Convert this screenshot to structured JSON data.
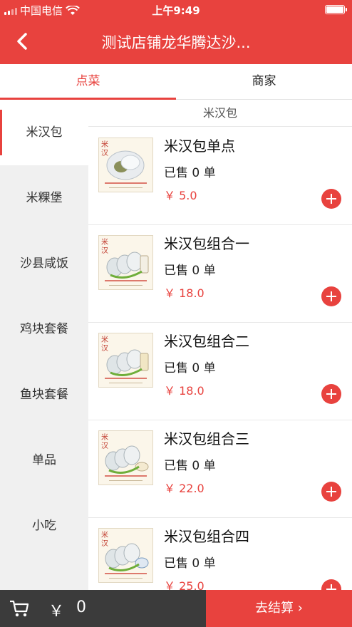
{
  "status_bar": {
    "carrier": "中国电信",
    "time": "上午9:49"
  },
  "header": {
    "title": "测试店铺龙华腾达沙..."
  },
  "tabs": [
    {
      "label": "点菜",
      "active": true
    },
    {
      "label": "商家",
      "active": false
    }
  ],
  "sidebar": {
    "categories": [
      "米汉包",
      "米粿堡",
      "沙县咸饭",
      "鸡块套餐",
      "鱼块套餐",
      "单品",
      "小吃"
    ],
    "active_index": 0
  },
  "main": {
    "section_title": "米汉包",
    "products": [
      {
        "name": "米汉包单点",
        "sold": "已售 0 单",
        "price": "￥ 5.0",
        "image_icon": "rice-burger-photo"
      },
      {
        "name": "米汉包组合一",
        "sold": "已售 0 单",
        "price": "￥ 18.0",
        "image_icon": "rice-burger-combo-photo"
      },
      {
        "name": "米汉包组合二",
        "sold": "已售 0 单",
        "price": "￥ 18.0",
        "image_icon": "rice-burger-combo-photo"
      },
      {
        "name": "米汉包组合三",
        "sold": "已售 0 单",
        "price": "￥ 22.0",
        "image_icon": "rice-burger-combo-photo"
      },
      {
        "name": "米汉包组合四",
        "sold": "已售 0 单",
        "price": "￥ 25.0",
        "image_icon": "rice-burger-combo-photo"
      }
    ]
  },
  "bottom_bar": {
    "currency": "￥",
    "total": "0",
    "checkout_label": "去结算 ›"
  },
  "colors": {
    "brand": "#e8423e",
    "bottom_bar": "#3b3b3b",
    "sidebar_bg": "#f0f0f0"
  },
  "battery_level": 1.0
}
